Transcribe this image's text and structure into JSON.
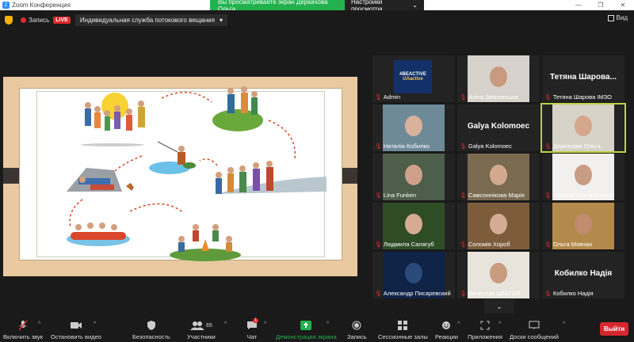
{
  "window": {
    "title": "Zoom Конференция"
  },
  "share": {
    "status": "Вы просматриваете экран Деркачова Ольга",
    "view_options": "Настройки просмотра"
  },
  "topbar": {
    "rec_label": "Запись",
    "live_label": "LIVE",
    "stream_label": "Индивидуальная служба потокового вещания",
    "view_label": "Вид"
  },
  "colors": {
    "live": "#e02828",
    "share_green": "#23b14d",
    "active_speaker": "#b9d343",
    "leave": "#d6272f"
  },
  "participants": [
    {
      "name": "Admin",
      "kind": "logo",
      "logo_line1": "#BEACTIVE",
      "logo_line2": "UAactive"
    },
    {
      "name": "Аліна Землянська",
      "kind": "photo",
      "bg": "#d8d2cc",
      "skin": "#c89a80"
    },
    {
      "name": "Тетяна Шарова ІМЗО",
      "kind": "text",
      "display": "Тетяна Шарова..."
    },
    {
      "name": "Наталія Кобилко",
      "kind": "photo",
      "bg": "#6e8a98",
      "skin": "#d9b29b"
    },
    {
      "name": "Galya Kolomoec",
      "kind": "text",
      "display": "Galya Kolomoec"
    },
    {
      "name": "Деркачова Ольга",
      "kind": "photo",
      "bg": "#d8d3c8",
      "skin": "#d4a78d",
      "active": true
    },
    {
      "name": "Lina Funken",
      "kind": "photo",
      "bg": "#4d5e4b",
      "skin": "#cfa18b"
    },
    {
      "name": "Самсоннікова Марія",
      "kind": "photo",
      "bg": "#7a6a50",
      "skin": "#d2a98f"
    },
    {
      "name": "Наталія Помаранська",
      "kind": "photo",
      "bg": "#f2f0ee",
      "skin": "#c99c84"
    },
    {
      "name": "Людмила Салагуб",
      "kind": "photo",
      "bg": "#2e4d27",
      "skin": "#d7ab92"
    },
    {
      "name": "Соломія Хороб",
      "kind": "photo",
      "bg": "#7d5c3c",
      "skin": "#d4ac93"
    },
    {
      "name": "Ольга Мовчан",
      "kind": "photo",
      "bg": "#b48a4c",
      "skin": "#c28c70"
    },
    {
      "name": "Александр Писаревский",
      "kind": "photo",
      "bg": "#0f2346",
      "skin": "#2a4a7a"
    },
    {
      "name": "Вячеслав ЦВАТИЙ",
      "kind": "photo",
      "bg": "#e8e4dc",
      "skin": "#c99b7f"
    },
    {
      "name": "Кобилко Надія",
      "kind": "text",
      "display": "Кобилко Надія"
    }
  ],
  "toolbar": {
    "unmute": "Включить звук",
    "stop_video": "Остановить видео",
    "security": "Безопасность",
    "participants": "Участники",
    "participants_count": "65",
    "chat": "Чат",
    "chat_badge": "1",
    "share_screen": "Демонстрация экрана",
    "record": "Запись",
    "breakout": "Сессионные залы",
    "reactions": "Реакции",
    "apps": "Приложения",
    "whiteboard": "Доски сообщений",
    "leave": "Выйти"
  }
}
